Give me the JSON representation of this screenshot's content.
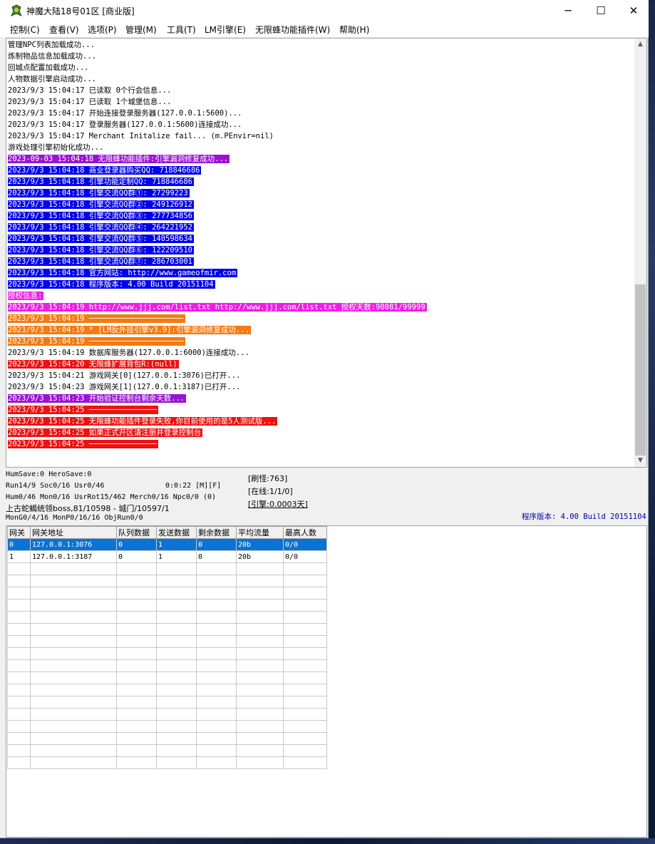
{
  "window": {
    "title": "神魔大陆18号01区 [商业版]",
    "controls": {
      "minimize": "─",
      "maximize": "☐",
      "close": "✕"
    }
  },
  "menu": [
    {
      "label": "控制(C)"
    },
    {
      "label": "查看(V)"
    },
    {
      "label": "选项(P)"
    },
    {
      "label": "管理(M)"
    },
    {
      "label": "工具(T)"
    },
    {
      "label": "LM引擎(E)"
    },
    {
      "label": "无限蜂功能插件(W)"
    },
    {
      "label": "帮助(H)"
    }
  ],
  "log": [
    {
      "text": "管理NPC列表加载成功...",
      "style": "plain"
    },
    {
      "text": "炼制物品信息加载成功...",
      "style": "plain"
    },
    {
      "text": "回城点配置加载成功...",
      "style": "plain"
    },
    {
      "text": "人物数据引擎启动成功...",
      "style": "plain"
    },
    {
      "text": "2023/9/3 15:04:17 已读取 0个行会信息...",
      "style": "plain"
    },
    {
      "text": "2023/9/3 15:04:17 已读取 1个城堡信息...",
      "style": "plain"
    },
    {
      "text": "2023/9/3 15:04:17 开始连接登录服务器(127.0.0.1:5600)...",
      "style": "plain"
    },
    {
      "text": "2023/9/3 15:04:17 登录服务器(127.0.0.1:5600)连接成功...",
      "style": "plain"
    },
    {
      "text": "2023/9/3 15:04:17   Merchant Initalize fail... (m.PEnvir=nil)",
      "style": "plain"
    },
    {
      "text": "游戏处理引擎初始化成功...",
      "style": "plain"
    },
    {
      "text": "2023-09-03 15:04:18 无限蜂功能插件:引擎漏洞修复成功...",
      "style": "purple"
    },
    {
      "text": "2023/9/3 15:04:18 商业登录器购买QQ: 718846686",
      "style": "blue"
    },
    {
      "text": "2023/9/3 15:04:18 引擎功能定制QQ: 718846686",
      "style": "blue"
    },
    {
      "text": "2023/9/3 15:04:18 引擎交流QQ群①: 27299223",
      "style": "blue"
    },
    {
      "text": "2023/9/3 15:04:18 引擎交流QQ群②: 249126912",
      "style": "blue"
    },
    {
      "text": "2023/9/3 15:04:18 引擎交流QQ群③: 277734856",
      "style": "blue"
    },
    {
      "text": "2023/9/3 15:04:18 引擎交流QQ群④: 264221952",
      "style": "blue"
    },
    {
      "text": "2023/9/3 15:04:18 引擎交流QQ群⑤: 140598634",
      "style": "blue"
    },
    {
      "text": "2023/9/3 15:04:18 引擎交流QQ群⑥: 122209510",
      "style": "blue"
    },
    {
      "text": "2023/9/3 15:04:18 引擎交流QQ群⑦: 286703001",
      "style": "blue"
    },
    {
      "text": "2023/9/3 15:04:18 官方网站: http://www.gameofmir.com",
      "style": "blue"
    },
    {
      "text": "2023/9/3 15:04:18 程序版本: 4.00 Build 20151104",
      "style": "blue"
    },
    {
      "text": "授权信息:",
      "style": "magenta"
    },
    {
      "text": "2023/9/3 15:04:19 http://www.jjj.com/list.txt http://www.jjj.com/list.txt 授权天数:98081/99999",
      "style": "magenta"
    },
    {
      "text": "2023/9/3 15:04:19 ─────────────────────",
      "style": "orange"
    },
    {
      "text": "2023/9/3 15:04:19 * [LM反外挂引擎v3.9]:引擎漏洞修复成功...",
      "style": "orange"
    },
    {
      "text": "2023/9/3 15:04:19 ─────────────────────",
      "style": "orange"
    },
    {
      "text": "2023/9/3 15:04:19 数据库服务器(127.0.0.1:6000)连接成功...",
      "style": "plain"
    },
    {
      "text": "2023/9/3 15:04:20 无限蜂扩展背包R:(null)",
      "style": "red"
    },
    {
      "text": "2023/9/3 15:04:21 游戏网关[0](127.0.0.1:3076)已打开...",
      "style": "plain"
    },
    {
      "text": "2023/9/3 15:04:23 游戏网关[1](127.0.0.1:3187)已打开...",
      "style": "plain"
    },
    {
      "text": "2023/9/3 15:04:23 开始验证控制台剩余天数...",
      "style": "purple"
    },
    {
      "text": "2023/9/3 15:04:25 ───────────────",
      "style": "red"
    },
    {
      "text": "2023/9/3 15:04:25 无限蜂功能插件登录失败,你目前使用的是5人测试版...",
      "style": "red"
    },
    {
      "text": "2023/9/3 15:04:25 如果正式开区请注册并登录控制台",
      "style": "red"
    },
    {
      "text": "2023/9/3 15:04:25 ───────────────",
      "style": "red"
    }
  ],
  "status": {
    "line1": "HumSave:0 HeroSave:0",
    "line2a": "Run14/9 Soc0/16 Usr0/46",
    "line2b": "0:0:22 [M][F]",
    "line3": "Hum0/46 Mon0/16 UsrRot15/462 Merch0/16 Npc0/0 (0)",
    "line4": "上古蛇蝎统领boss,81/10598 - 城门/10597/1",
    "line5": "MonG0/4/16 MonP0/16/16 ObjRun0/0",
    "refresh": "[刷怪:763]",
    "online": "[在线:1/1/0]",
    "engine": "[引擎:0.0003天]",
    "version": "程序版本: 4.00 Build 20151104"
  },
  "gateway_table": {
    "columns": [
      "网关",
      "网关地址",
      "队列数据",
      "发送数据",
      "剩余数据",
      "平均流量",
      "最高人数"
    ],
    "rows": [
      [
        "0",
        "127.0.0.1:3076",
        "0",
        "1",
        "0",
        "20b",
        "0/0"
      ],
      [
        "1",
        "127.0.0.1:3187",
        "0",
        "1",
        "0",
        "20b",
        "0/0"
      ]
    ],
    "selected_row": 0
  }
}
